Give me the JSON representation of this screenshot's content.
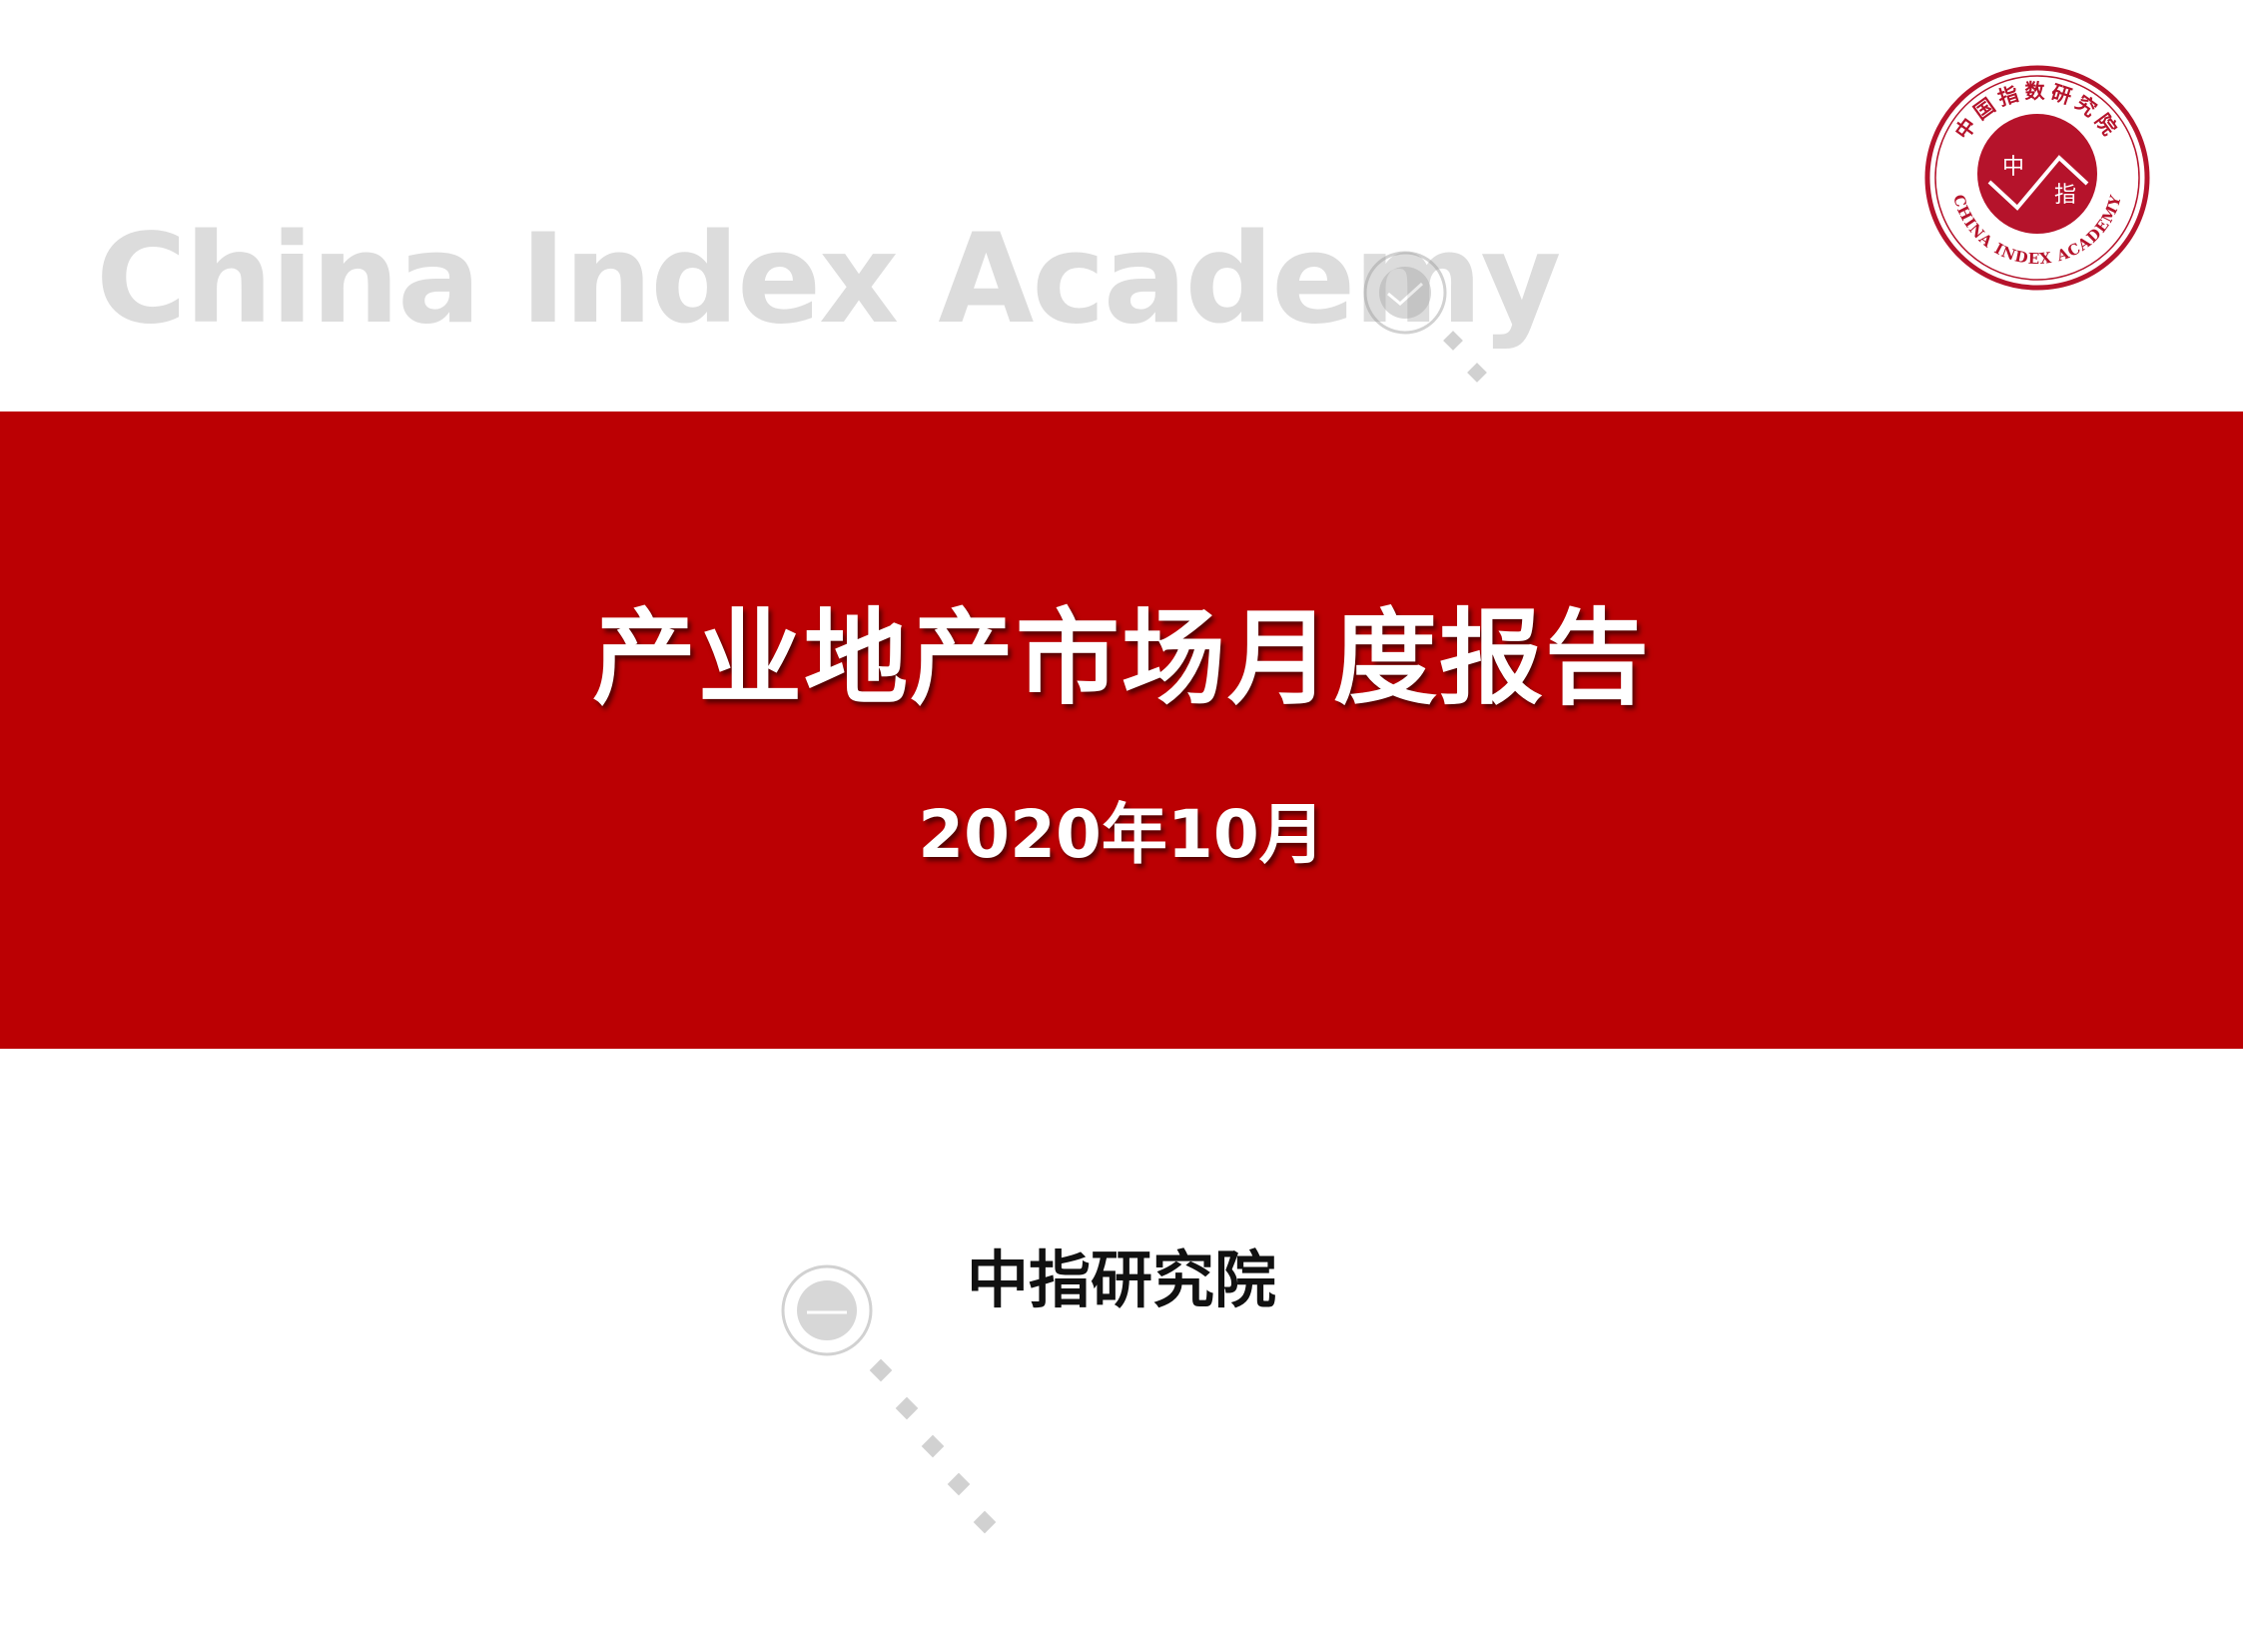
{
  "background_brand": "China Index Academy",
  "title": "产业地产市场月度报告",
  "date": "2020年10月",
  "organization": "中指研究院",
  "logo": {
    "icon": "china-index-academy-seal",
    "ring_text_top": "中国指数研究院",
    "ring_text_bottom": "CHINA INDEX ACADEMY",
    "center_text_1": "中",
    "center_text_2": "指"
  },
  "watermark": {
    "icon": "faint-seal-watermark",
    "text": "中指研究院"
  },
  "colors": {
    "banner": "#bb0003",
    "logo_red": "#b5132b",
    "brand_gray": "#dcdcdc"
  }
}
